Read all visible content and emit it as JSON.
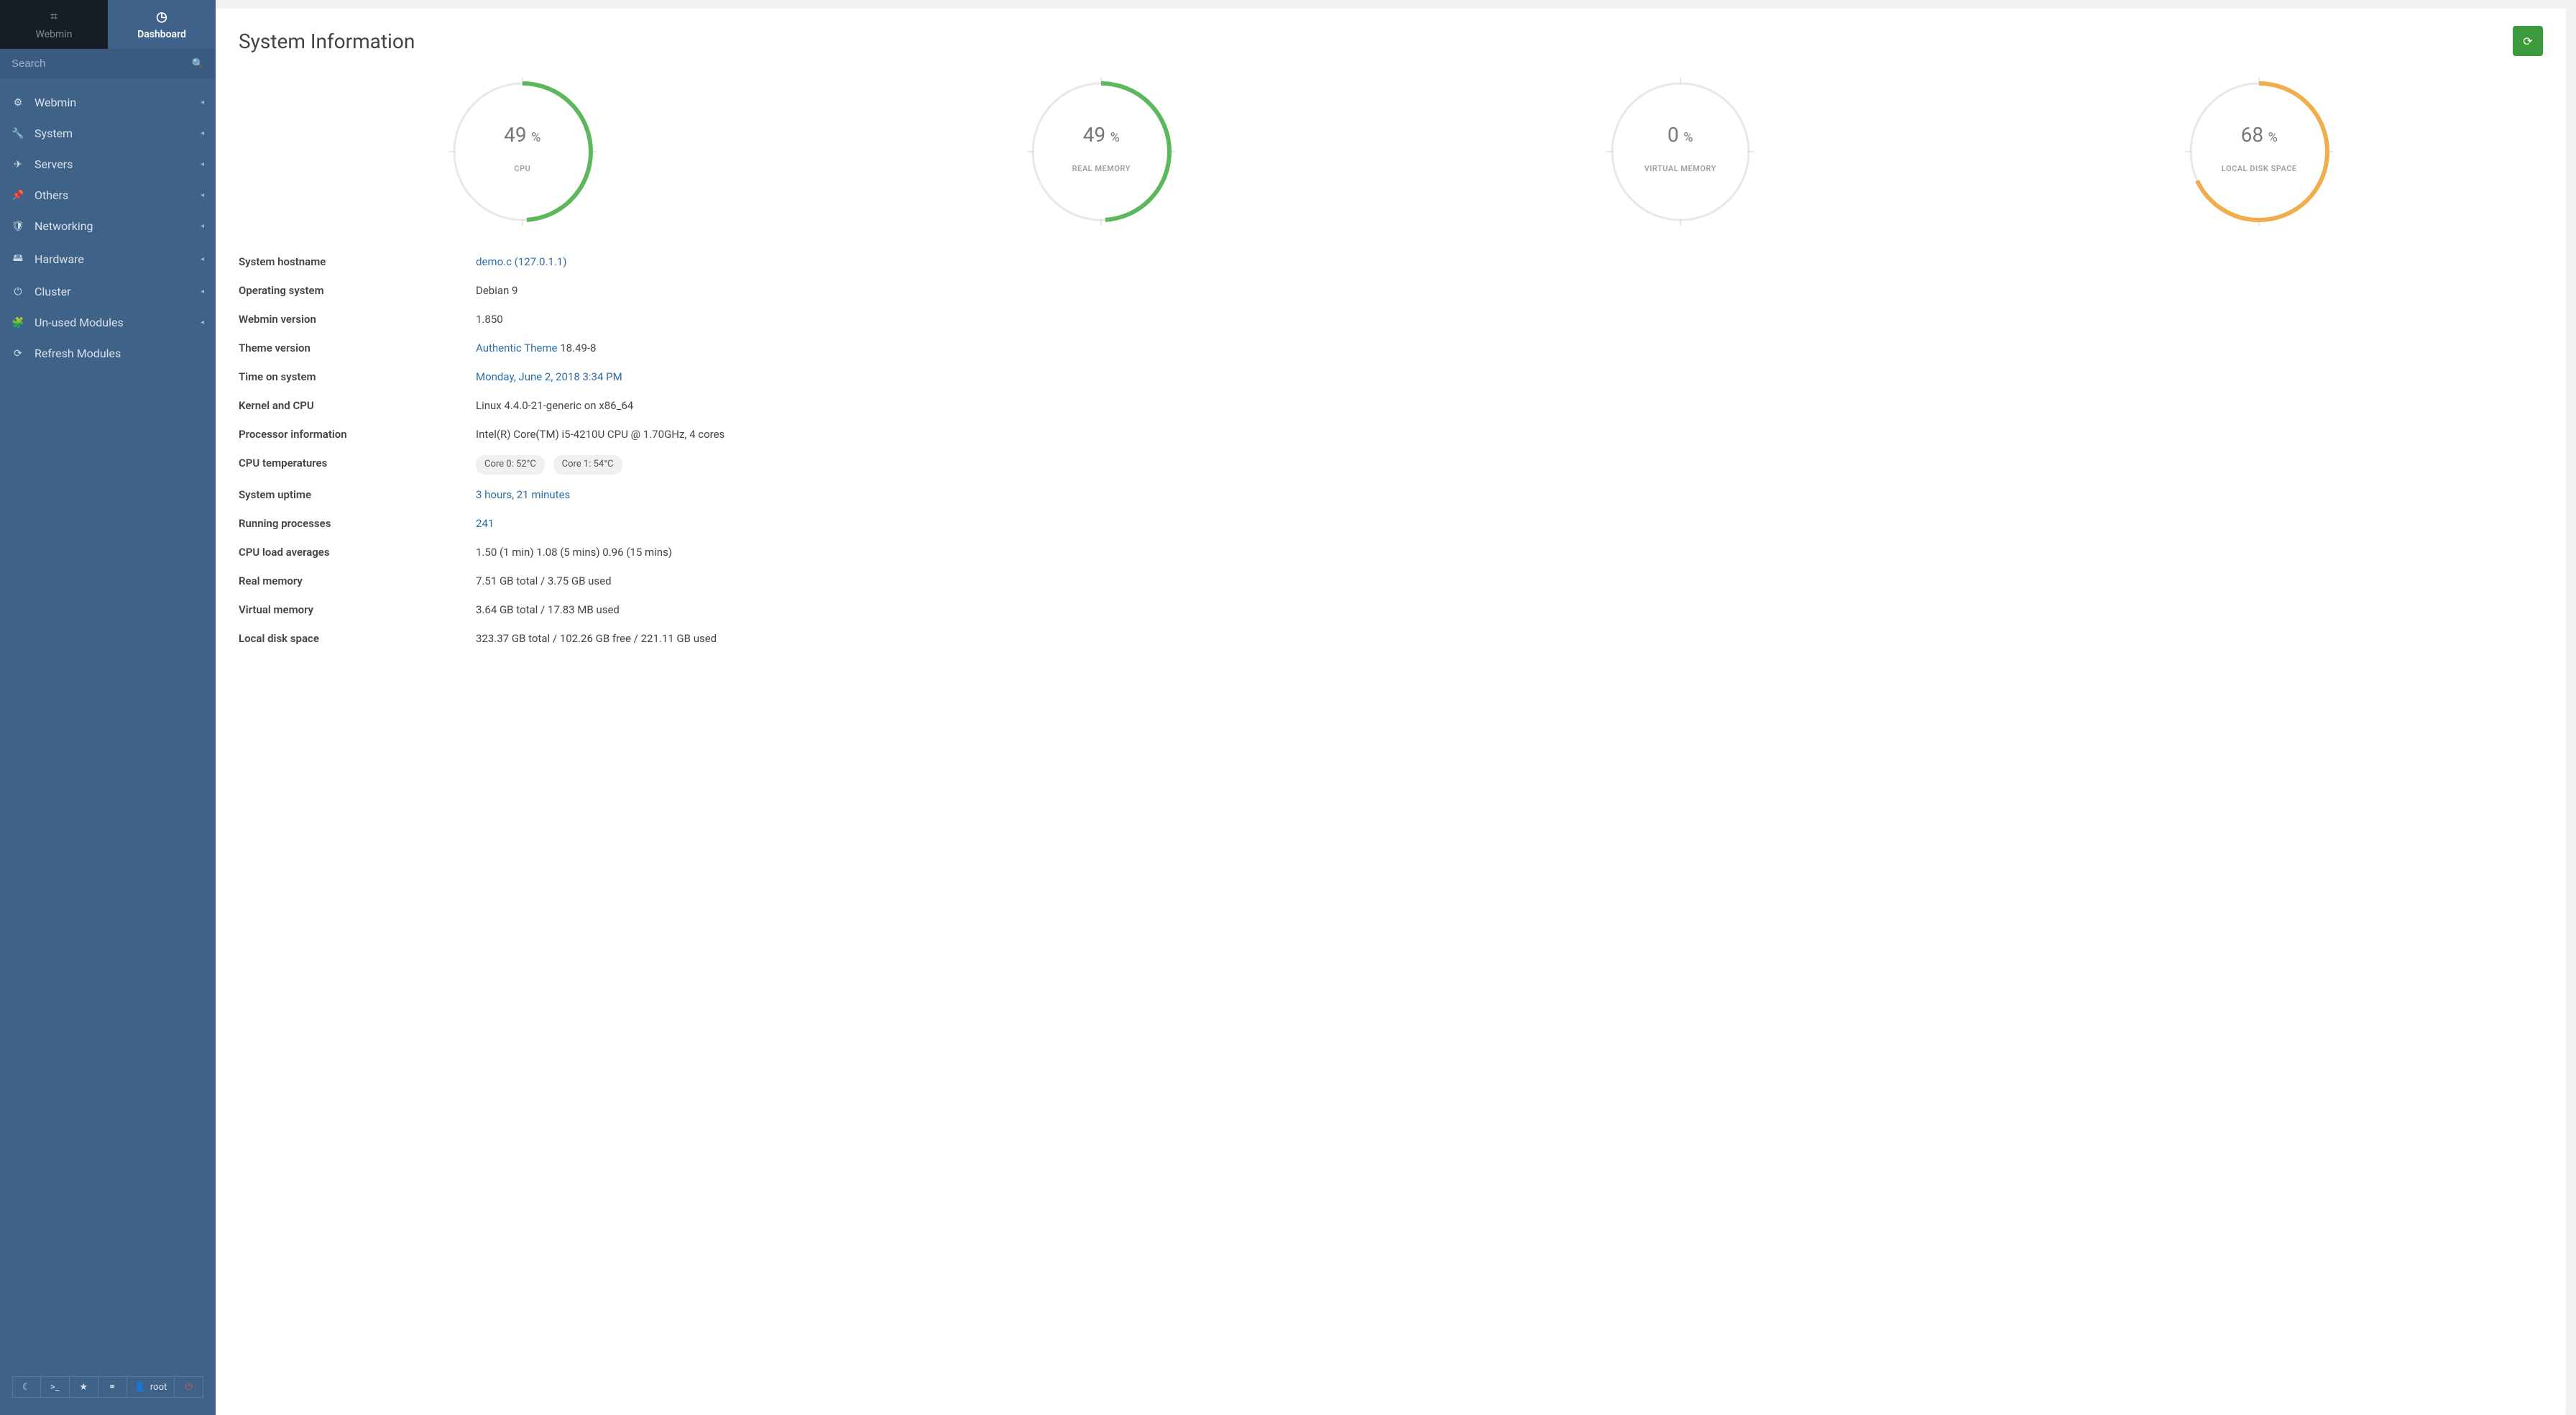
{
  "tabs": {
    "webmin": "Webmin",
    "dashboard": "Dashboard"
  },
  "search": {
    "placeholder": "Search"
  },
  "nav": [
    {
      "label": "Webmin",
      "icon": "⚙",
      "chev": true
    },
    {
      "label": "System",
      "icon": "🔧",
      "chev": true
    },
    {
      "label": "Servers",
      "icon": "✈",
      "chev": true
    },
    {
      "label": "Others",
      "icon": "📌",
      "chev": true
    },
    {
      "label": "Networking",
      "icon": "🛡",
      "chev": true
    },
    {
      "label": "Hardware",
      "icon": "🖴",
      "chev": true
    },
    {
      "label": "Cluster",
      "icon": "⏻",
      "chev": true
    },
    {
      "label": "Un-used Modules",
      "icon": "🧩",
      "chev": true
    },
    {
      "label": "Refresh Modules",
      "icon": "⟳",
      "chev": false
    }
  ],
  "footer": {
    "moon": "☾",
    "terminal": ">_",
    "star": "★",
    "share": "⚭",
    "user_icon": "👤",
    "user_label": "root",
    "power": "⏻"
  },
  "page": {
    "title": "System Information"
  },
  "gauges": [
    {
      "value": 49,
      "label": "CPU",
      "color": "#5db85d"
    },
    {
      "value": 49,
      "label": "REAL MEMORY",
      "color": "#5db85d"
    },
    {
      "value": 0,
      "label": "VIRTUAL MEMORY",
      "color": "#5db85d"
    },
    {
      "value": 68,
      "label": "LOCAL DISK SPACE",
      "color": "#f0ad4e"
    }
  ],
  "rows": {
    "hostname_label": "System hostname",
    "hostname_value": "demo.c  (127.0.1.1)",
    "os_label": "Operating system",
    "os_value": "Debian 9",
    "webmin_label": "Webmin version",
    "webmin_value": "1.850",
    "theme_label": "Theme version",
    "theme_link": "Authentic Theme",
    "theme_rest": " 18.49-8",
    "time_label": "Time on system",
    "time_value": "Monday, June 2, 2018 3:34 PM",
    "kernel_label": "Kernel and CPU",
    "kernel_value": "Linux 4.4.0-21-generic on x86_64",
    "proc_label": "Processor information",
    "proc_value": "Intel(R) Core(TM) i5-4210U CPU @ 1.70GHz, 4 cores",
    "temps_label": "CPU temperatures",
    "temp0": "Core 0: 52°C",
    "temp1": "Core 1: 54°C",
    "uptime_label": "System uptime",
    "uptime_value": "3 hours, 21 minutes",
    "procs_label": "Running processes",
    "procs_value": "241",
    "load_label": "CPU load averages",
    "load_value": "1.50 (1 min) 1.08 (5 mins) 0.96 (15 mins)",
    "rmem_label": "Real memory",
    "rmem_value": "7.51 GB total / 3.75 GB used",
    "vmem_label": "Virtual memory",
    "vmem_value": "3.64 GB total / 17.83 MB used",
    "disk_label": "Local disk space",
    "disk_value": "323.37 GB total / 102.26 GB free / 221.11 GB used"
  },
  "chart_data": {
    "type": "pie",
    "series": [
      {
        "name": "CPU",
        "values": [
          49
        ],
        "unit": "%"
      },
      {
        "name": "REAL MEMORY",
        "values": [
          49
        ],
        "unit": "%"
      },
      {
        "name": "VIRTUAL MEMORY",
        "values": [
          0
        ],
        "unit": "%"
      },
      {
        "name": "LOCAL DISK SPACE",
        "values": [
          68
        ],
        "unit": "%"
      }
    ]
  }
}
